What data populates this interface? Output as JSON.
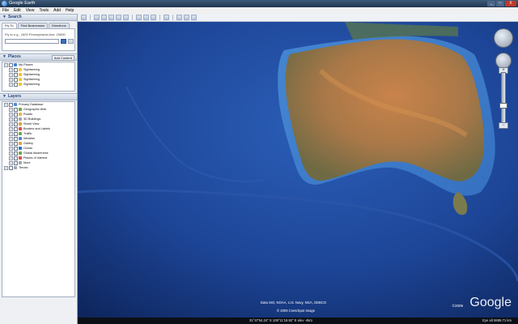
{
  "window": {
    "title": "Google Earth",
    "buttons": [
      "_",
      "□",
      "X"
    ]
  },
  "menu": [
    "File",
    "Edit",
    "View",
    "Tools",
    "Add",
    "Help"
  ],
  "toolbar": {
    "icons": [
      "sidebar-toggle-icon",
      "placemark-icon",
      "polygon-icon",
      "path-icon",
      "image-overlay-icon",
      "record-tour-icon",
      "historical-imagery-icon",
      "sun-icon",
      "planets-icon",
      "ruler-icon",
      "email-icon",
      "print-icon",
      "view-in-maps-icon"
    ]
  },
  "search": {
    "header": "Search",
    "tabs": [
      "Fly To",
      "Find Businesses",
      "Directions"
    ],
    "hint": "Fly to e.g., 1600 Pennsylvania Ave, 20500",
    "value": ""
  },
  "places": {
    "header": "Places",
    "add_content": "Add Content",
    "items": [
      {
        "label": "My Places",
        "level": 0,
        "color": "#3f7fd6"
      },
      {
        "label": "Sightseeing",
        "level": 1,
        "color": "#f2c530"
      },
      {
        "label": "Sightseeing",
        "level": 1,
        "color": "#f2c530"
      },
      {
        "label": "Sightseeing",
        "level": 1,
        "color": "#f2c530"
      },
      {
        "label": "Sightseeing",
        "level": 1,
        "color": "#f2c530"
      }
    ]
  },
  "layers": {
    "header": "Layers",
    "items": [
      {
        "label": "Primary Database",
        "level": 0,
        "color": "#4c8ad8"
      },
      {
        "label": "Geographic Web",
        "level": 1,
        "color": "#6aa84f"
      },
      {
        "label": "Roads",
        "level": 1,
        "color": "#e8b84a"
      },
      {
        "label": "3D Buildings",
        "level": 1,
        "color": "#9ea7b3"
      },
      {
        "label": "Street View",
        "level": 1,
        "color": "#e0a33a"
      },
      {
        "label": "Borders and Labels",
        "level": 1,
        "color": "#d9534f"
      },
      {
        "label": "Traffic",
        "level": 1,
        "color": "#6aa84f"
      },
      {
        "label": "Weather",
        "level": 1,
        "color": "#4c8ad8"
      },
      {
        "label": "Gallery",
        "level": 1,
        "color": "#e0a33a"
      },
      {
        "label": "Ocean",
        "level": 1,
        "color": "#2f73c8"
      },
      {
        "label": "Global Awareness",
        "level": 1,
        "color": "#6aa84f"
      },
      {
        "label": "Places of Interest",
        "level": 1,
        "color": "#d9534f"
      },
      {
        "label": "More",
        "level": 1,
        "color": "#9ea7b3"
      },
      {
        "label": "Terrain",
        "level": 0,
        "color": "#9ea7b3"
      }
    ]
  },
  "map": {
    "copyright_1": "Data SIO, NOAA, U.S. Navy, NGA, GEBCO",
    "copyright_2": "© 2009 Cnes/Spot Image",
    "logo": "Google",
    "logo_year": "©2009",
    "zoom_level": 0.6
  },
  "status": {
    "coords": "31°47'54.24\" S     109°11'18.92\" E   elev   -4km",
    "eye_alt": "Eye alt 5898.71 km"
  }
}
